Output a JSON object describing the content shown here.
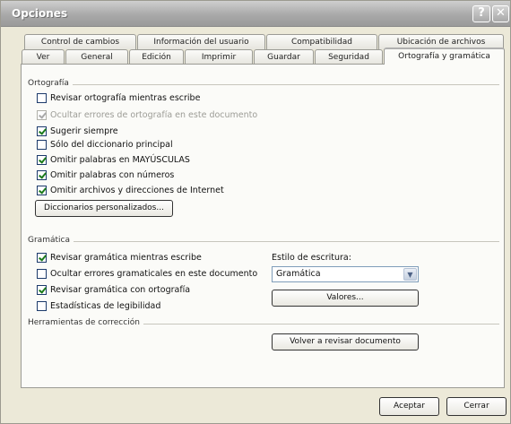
{
  "window": {
    "title": "Opciones",
    "help_glyph": "?",
    "close_glyph": "✕"
  },
  "tabs": {
    "row_back": [
      "Control de cambios",
      "Información del usuario",
      "Compatibilidad",
      "Ubicación de archivos"
    ],
    "row_front": [
      "Ver",
      "General",
      "Edición",
      "Imprimir",
      "Guardar",
      "Seguridad",
      "Ortografía y gramática"
    ],
    "active": "Ortografía y gramática"
  },
  "ortografia": {
    "group_label": "Ortografía",
    "options": [
      {
        "label": "Revisar ortografía mientras escribe",
        "checked": false,
        "disabled": false
      },
      {
        "label": "Ocultar errores de ortografía en este documento",
        "checked": true,
        "disabled": true
      },
      {
        "label": "Sugerir siempre",
        "checked": true,
        "disabled": false
      },
      {
        "label": "Sólo del diccionario principal",
        "checked": false,
        "disabled": false
      },
      {
        "label": "Omitir palabras en MAYÚSCULAS",
        "checked": true,
        "disabled": false
      },
      {
        "label": "Omitir palabras con números",
        "checked": true,
        "disabled": false
      },
      {
        "label": "Omitir archivos y direcciones de Internet",
        "checked": true,
        "disabled": false
      }
    ],
    "dict_button": "Diccionarios personalizados..."
  },
  "gramatica": {
    "group_label": "Gramática",
    "options": [
      {
        "label": "Revisar gramática mientras escribe",
        "checked": true
      },
      {
        "label": "Ocultar errores gramaticales en este documento",
        "checked": false
      },
      {
        "label": "Revisar gramática con ortografía",
        "checked": true
      },
      {
        "label": "Estadísticas de legibilidad",
        "checked": false
      }
    ],
    "style_label": "Estilo de escritura:",
    "style_value": "Gramática",
    "settings_button": "Valores..."
  },
  "herramientas": {
    "group_label": "Herramientas de corrección",
    "recheck_button": "Volver a revisar documento"
  },
  "footer": {
    "ok": "Aceptar",
    "cancel": "Cerrar"
  }
}
